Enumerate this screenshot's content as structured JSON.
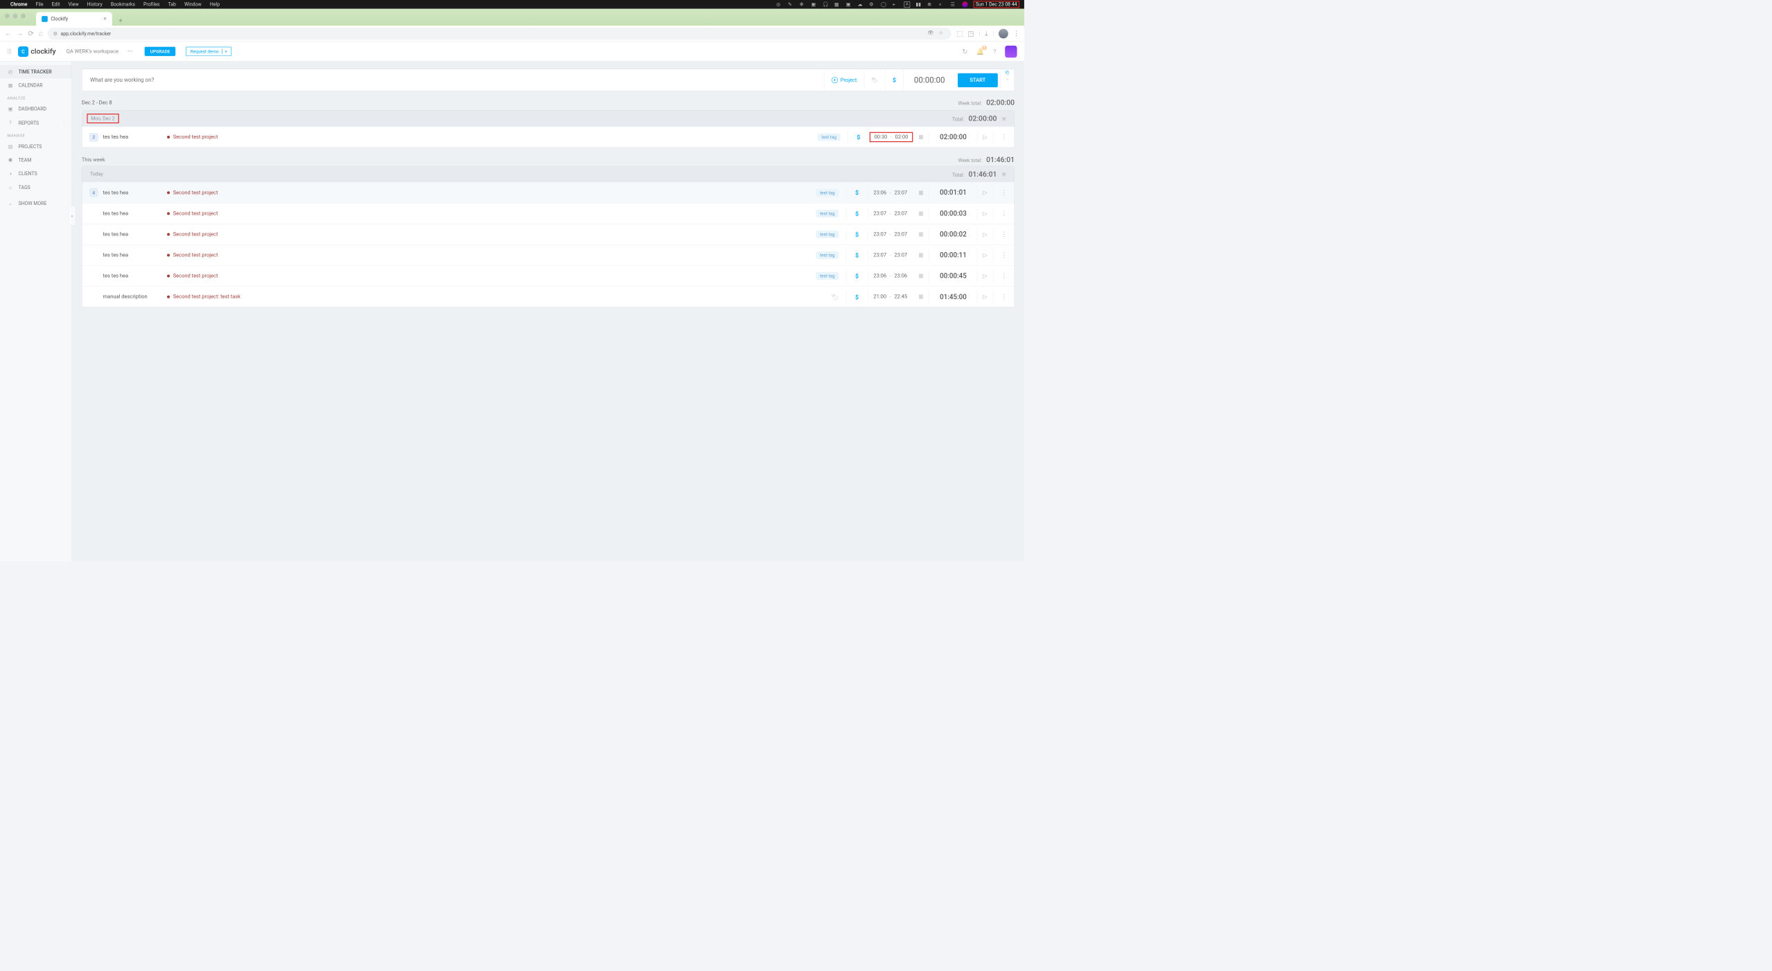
{
  "mac": {
    "app": "Chrome",
    "menus": [
      "File",
      "Edit",
      "View",
      "History",
      "Bookmarks",
      "Profiles",
      "Tab",
      "Window",
      "Help"
    ],
    "datetime": "Sun 1 Dec  23 08 44"
  },
  "browser": {
    "tab_title": "Clockify",
    "url": "app.clockify.me/tracker"
  },
  "header": {
    "logo_text": "clockify",
    "workspace": "QA WERK's workspace",
    "upgrade": "UPGRADE",
    "demo": "Request demo",
    "notif_badge": "1"
  },
  "sidebar": {
    "items": [
      {
        "icon": "◴",
        "label": "TIME TRACKER",
        "active": true
      },
      {
        "icon": "▦",
        "label": "CALENDAR"
      }
    ],
    "analyze_label": "ANALYZE",
    "analyze": [
      {
        "icon": "▣",
        "label": "DASHBOARD"
      },
      {
        "icon": "⫯",
        "label": "REPORTS",
        "chev": true
      }
    ],
    "manage_label": "MANAGE",
    "manage": [
      {
        "icon": "▤",
        "label": "PROJECTS"
      },
      {
        "icon": "⚉",
        "label": "TEAM"
      },
      {
        "icon": "◑",
        "label": "CLIENTS"
      },
      {
        "icon": "⌂",
        "label": "TAGS"
      }
    ],
    "show_more": "SHOW MORE"
  },
  "tracker": {
    "placeholder": "What are you working on?",
    "project_label": "Project",
    "timer": "00:00:00",
    "start": "START"
  },
  "range": {
    "text": "Dec 2 - Dec 8",
    "week_total_label": "Week total:",
    "week_total": "02:00:00"
  },
  "blocks": [
    {
      "date": "Mon, Dec 2",
      "date_boxed": true,
      "total_label": "Total:",
      "total": "02:00:00",
      "entries": [
        {
          "count": "2",
          "desc": "tes tes hea",
          "project": "Second test project",
          "tag": "test tag",
          "start": "00:30",
          "end": "02:00",
          "times_boxed": true,
          "dur": "02:00:00"
        }
      ]
    }
  ],
  "week": {
    "label": "This week",
    "total_label": "Week total:",
    "total": "01:46:01"
  },
  "today": {
    "date": "Today",
    "total_label": "Total:",
    "total": "01:46:01",
    "entries": [
      {
        "count": "4",
        "desc": "tes tes hea",
        "project": "Second test project",
        "tag": "test tag",
        "start": "23:06",
        "end": "23:07",
        "dur": "00:01:01",
        "hl": true
      },
      {
        "desc": "tes tes hea",
        "project": "Second test project",
        "tag": "test tag",
        "start": "23:07",
        "end": "23:07",
        "dur": "00:00:03"
      },
      {
        "desc": "tes tes hea",
        "project": "Second test project",
        "tag": "test tag",
        "start": "23:07",
        "end": "23:07",
        "dur": "00:00:02"
      },
      {
        "desc": "tes tes hea",
        "project": "Second test project",
        "tag": "test tag",
        "start": "23:07",
        "end": "23:07",
        "dur": "00:00:11"
      },
      {
        "desc": "tes tes hea",
        "project": "Second test project",
        "tag": "test tag",
        "start": "23:06",
        "end": "23:06",
        "dur": "00:00:45"
      },
      {
        "desc": "manual description",
        "project": "Second test project: test task",
        "no_tag": true,
        "start": "21:00",
        "end": "22:45",
        "dur": "01:45:00"
      }
    ]
  }
}
